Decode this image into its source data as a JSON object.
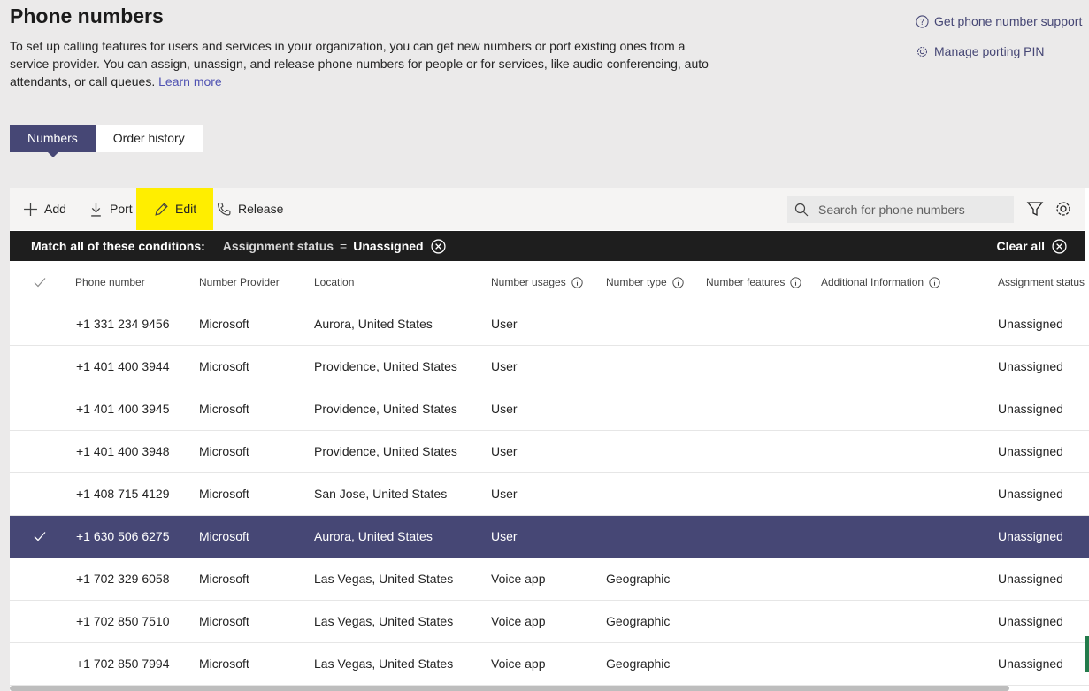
{
  "page": {
    "title": "Phone numbers",
    "intro": "To set up calling features for users and services in your organization, you can get new numbers or port existing ones from a service provider. You can assign, unassign, and release phone numbers for people or for services, like audio conferencing, auto attendants, or call queues.",
    "learn_more": "Learn more"
  },
  "links": {
    "support": "Get phone number support",
    "porting_pin": "Manage porting PIN"
  },
  "tabs": [
    {
      "label": "Numbers",
      "active": true
    },
    {
      "label": "Order history",
      "active": false
    }
  ],
  "toolbar": {
    "add": "Add",
    "port": "Port",
    "edit": "Edit",
    "release": "Release",
    "search_placeholder": "Search for phone numbers",
    "highlight_color": "#ffee00"
  },
  "filter": {
    "match": "Match all of these conditions:",
    "key": "Assignment status",
    "op": "=",
    "value": "Unassigned",
    "clear": "Clear all"
  },
  "columns": {
    "phone": "Phone number",
    "provider": "Number Provider",
    "location": "Location",
    "usages": "Number usages",
    "type": "Number type",
    "features": "Number features",
    "additional": "Additional Information",
    "status": "Assignment status"
  },
  "rows": [
    {
      "phone": "+1 331 234 9456",
      "provider": "Microsoft",
      "location": "Aurora, United States",
      "usage": "User",
      "type": "",
      "status": "Unassigned",
      "selected": false
    },
    {
      "phone": "+1 401 400 3944",
      "provider": "Microsoft",
      "location": "Providence, United States",
      "usage": "User",
      "type": "",
      "status": "Unassigned",
      "selected": false
    },
    {
      "phone": "+1 401 400 3945",
      "provider": "Microsoft",
      "location": "Providence, United States",
      "usage": "User",
      "type": "",
      "status": "Unassigned",
      "selected": false
    },
    {
      "phone": "+1 401 400 3948",
      "provider": "Microsoft",
      "location": "Providence, United States",
      "usage": "User",
      "type": "",
      "status": "Unassigned",
      "selected": false
    },
    {
      "phone": "+1 408 715 4129",
      "provider": "Microsoft",
      "location": "San Jose, United States",
      "usage": "User",
      "type": "",
      "status": "Unassigned",
      "selected": false
    },
    {
      "phone": "+1 630 506 6275",
      "provider": "Microsoft",
      "location": "Aurora, United States",
      "usage": "User",
      "type": "",
      "status": "Unassigned",
      "selected": true
    },
    {
      "phone": "+1 702 329 6058",
      "provider": "Microsoft",
      "location": "Las Vegas, United States",
      "usage": "Voice app",
      "type": "Geographic",
      "status": "Unassigned",
      "selected": false
    },
    {
      "phone": "+1 702 850 7510",
      "provider": "Microsoft",
      "location": "Las Vegas, United States",
      "usage": "Voice app",
      "type": "Geographic",
      "status": "Unassigned",
      "selected": false
    },
    {
      "phone": "+1 702 850 7994",
      "provider": "Microsoft",
      "location": "Las Vegas, United States",
      "usage": "Voice app",
      "type": "Geographic",
      "status": "Unassigned",
      "selected": false
    }
  ],
  "colors": {
    "accent": "#464775",
    "link": "#4f52b2"
  }
}
